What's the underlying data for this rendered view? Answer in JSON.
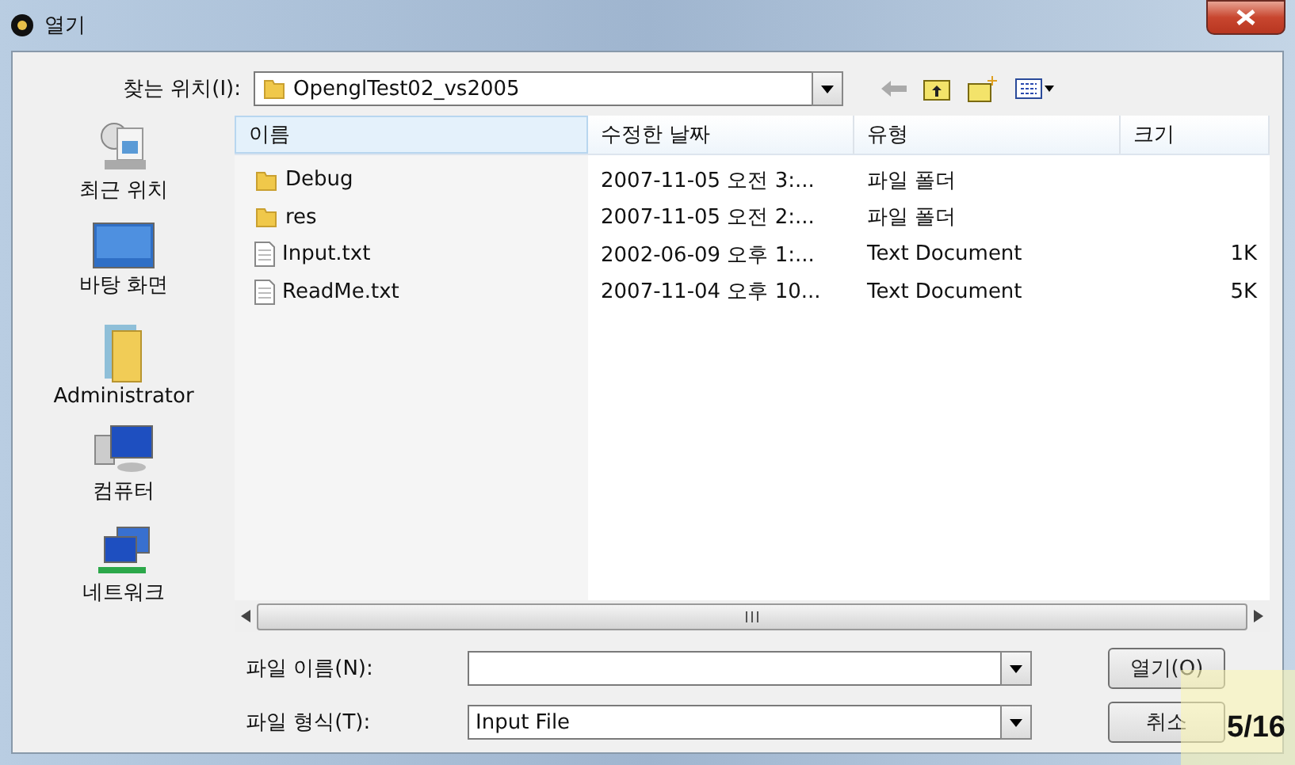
{
  "window": {
    "title": "열기"
  },
  "look_in": {
    "label": "찾는 위치(I):",
    "value": "OpenglTest02_vs2005"
  },
  "places": [
    {
      "label": "최근 위치",
      "kind": "recent"
    },
    {
      "label": "바탕 화면",
      "kind": "desktop"
    },
    {
      "label": "Administrator",
      "kind": "user"
    },
    {
      "label": "컴퓨터",
      "kind": "computer"
    },
    {
      "label": "네트워크",
      "kind": "network"
    }
  ],
  "table": {
    "columns": [
      "이름",
      "수정한 날짜",
      "유형",
      "크기"
    ],
    "rows": [
      {
        "kind": "folder",
        "cells": [
          "Debug",
          "2007-11-05 오전 3:...",
          "파일 폴더",
          ""
        ]
      },
      {
        "kind": "folder",
        "cells": [
          "res",
          "2007-11-05 오전 2:...",
          "파일 폴더",
          ""
        ]
      },
      {
        "kind": "file",
        "cells": [
          "Input.txt",
          "2002-06-09 오후 1:...",
          "Text Document",
          "1K"
        ]
      },
      {
        "kind": "file",
        "cells": [
          "ReadMe.txt",
          "2007-11-04 오후 10...",
          "Text Document",
          "5K"
        ]
      }
    ]
  },
  "file_name": {
    "label": "파일 이름(N):"
  },
  "file_type": {
    "label": "파일 형식(T):",
    "value": "Input File"
  },
  "buttons": [
    "열기(O)",
    "취소"
  ],
  "page_indicator": "5/16"
}
